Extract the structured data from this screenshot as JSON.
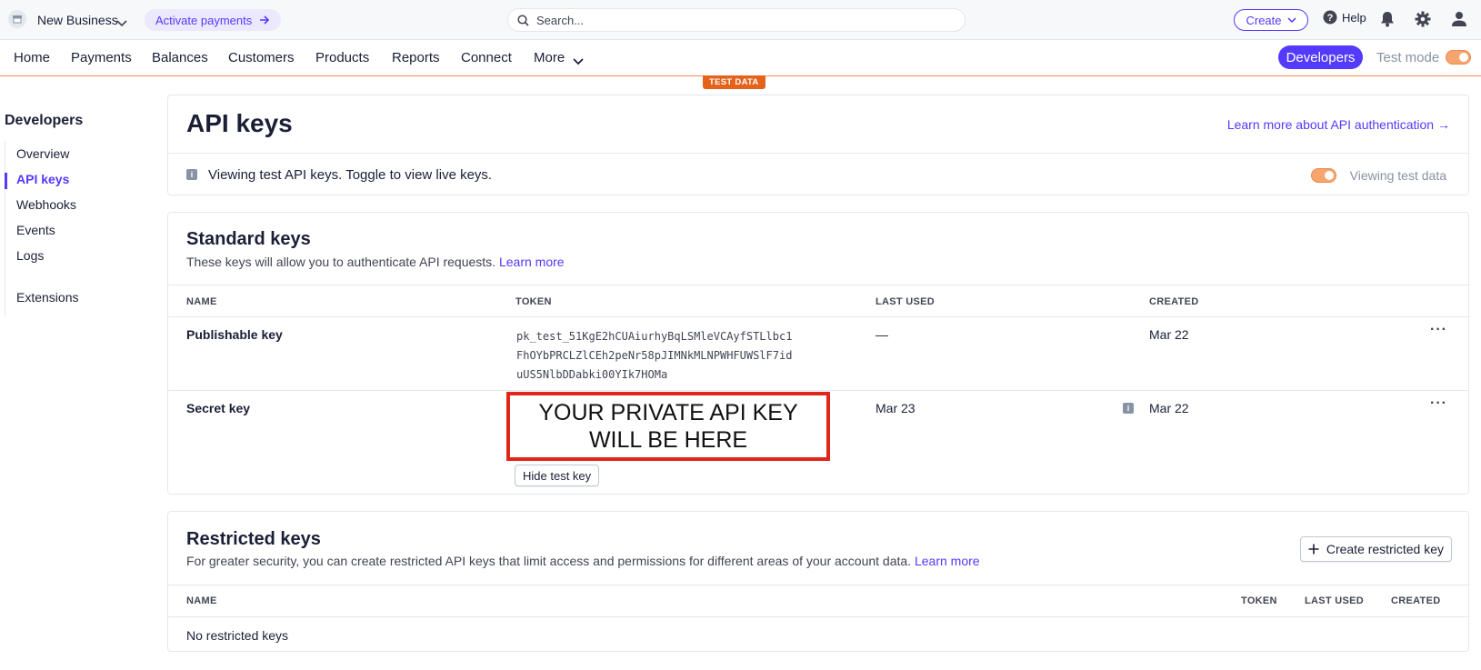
{
  "topbar": {
    "business_name": "New Business",
    "activate_label": "Activate payments",
    "search_placeholder": "Search...",
    "create_label": "Create",
    "help_label": "Help"
  },
  "nav": {
    "items": [
      "Home",
      "Payments",
      "Balances",
      "Customers",
      "Products",
      "Reports",
      "Connect",
      "More"
    ],
    "developers_label": "Developers",
    "test_mode_label": "Test mode",
    "test_data_badge": "TEST DATA"
  },
  "sidebar": {
    "title": "Developers",
    "items": [
      {
        "label": "Overview",
        "active": false
      },
      {
        "label": "API keys",
        "active": true
      },
      {
        "label": "Webhooks",
        "active": false
      },
      {
        "label": "Events",
        "active": false
      },
      {
        "label": "Logs",
        "active": false
      },
      {
        "label": "Extensions",
        "active": false
      }
    ]
  },
  "header_card": {
    "title": "API keys",
    "learn_link": "Learn more about API authentication →",
    "notice": "Viewing test API keys. Toggle to view live keys.",
    "toggle_label": "Viewing test data"
  },
  "standard_keys": {
    "title": "Standard keys",
    "description": "These keys will allow you to authenticate API requests.",
    "learn_more": "Learn more",
    "columns": [
      "NAME",
      "TOKEN",
      "LAST USED",
      "CREATED"
    ],
    "rows": [
      {
        "name": "Publishable key",
        "token_lines": [
          "pk_test_51KgE2hCUAiurhyBqLSMleVCAyfSTLlbc1",
          "FhOYbPRCLZlCEh2peNr58pJIMNkMLNPWHFUWSlF7id",
          "uUS5NlbDDabki00YIk7HOMa"
        ],
        "last_used": "—",
        "created": "Mar 22"
      },
      {
        "name": "Secret key",
        "token_overlay_line1": "YOUR PRIVATE API KEY",
        "token_overlay_line2": "WILL BE HERE",
        "last_used": "Mar 23",
        "created": "Mar 22",
        "hide_button": "Hide test key"
      }
    ]
  },
  "restricted_keys": {
    "title": "Restricted keys",
    "description": "For greater security, you can create restricted API keys that limit access and permissions for different areas of your account data.",
    "learn_more": "Learn more",
    "create_button": "Create restricted key",
    "columns": [
      "NAME",
      "TOKEN",
      "LAST USED",
      "CREATED"
    ],
    "empty_text": "No restricted keys"
  },
  "colors": {
    "accent": "#533afd",
    "test_orange": "#e5621b",
    "highlight_red": "#e0251b"
  }
}
